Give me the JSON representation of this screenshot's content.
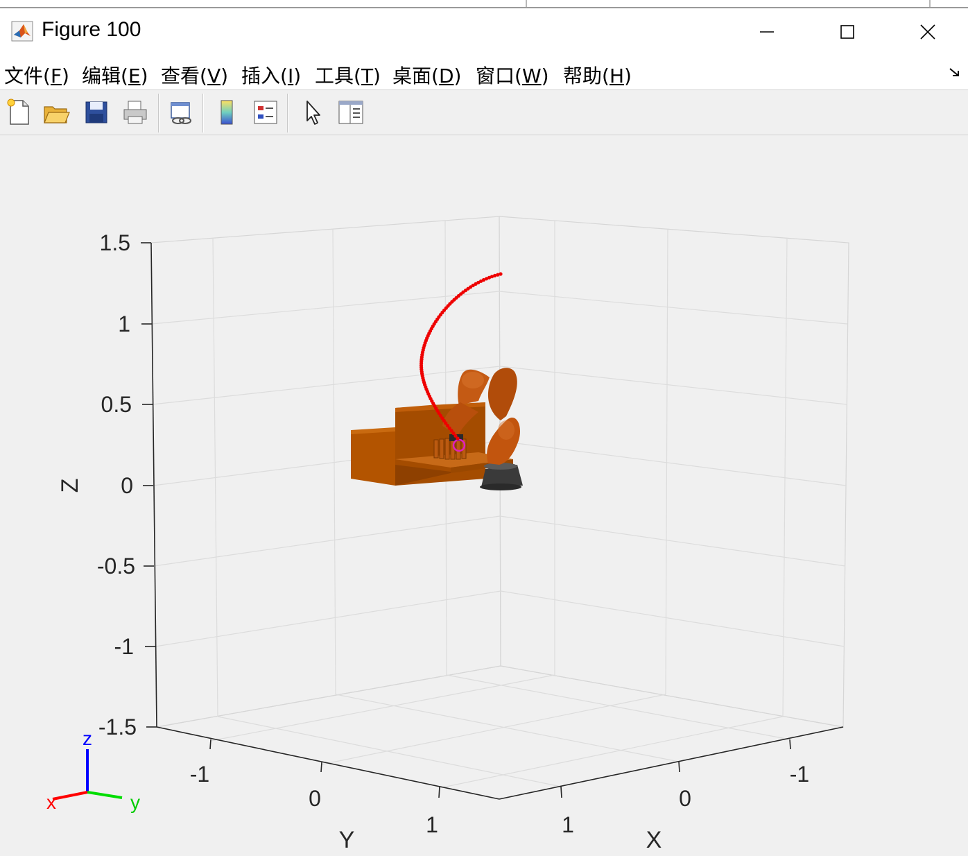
{
  "window": {
    "title": "Figure 100",
    "controls": {
      "minimize": "minimize",
      "maximize": "maximize",
      "close": "close"
    }
  },
  "menu": [
    {
      "label": "文件(",
      "key": "F",
      "tail": ")"
    },
    {
      "label": "编辑(",
      "key": "E",
      "tail": ")"
    },
    {
      "label": "查看(",
      "key": "V",
      "tail": ")"
    },
    {
      "label": "插入(",
      "key": "I",
      "tail": ")"
    },
    {
      "label": "工具(",
      "key": "T",
      "tail": ")"
    },
    {
      "label": "桌面(",
      "key": "D",
      "tail": ")"
    },
    {
      "label": "窗口(",
      "key": "W",
      "tail": ")"
    },
    {
      "label": "帮助(",
      "key": "H",
      "tail": ")"
    }
  ],
  "toolbar": {
    "buttons": [
      "new-figure",
      "open-file",
      "save-figure",
      "print-figure",
      "link-plot",
      "insert-colorbar",
      "insert-legend",
      "edit-plot",
      "property-inspector"
    ]
  },
  "plot": {
    "z_ticks": [
      "1.5",
      "1",
      "0.5",
      "0",
      "-0.5",
      "-1",
      "-1.5"
    ],
    "y_ticks": [
      "-1",
      "0",
      "1"
    ],
    "x_ticks": [
      "-1",
      "0",
      "1"
    ],
    "z_label": "Z",
    "y_label": "Y",
    "x_label": "X",
    "triad": {
      "x": "x",
      "y": "y",
      "z": "z"
    },
    "colors": {
      "trajectory": "#ee0000",
      "robot": "#c2550e",
      "table": "#b35400",
      "base": "#333333",
      "marker": "#e020c0",
      "triad_x": "#ff0000",
      "triad_y": "#00dd00",
      "triad_z": "#0000ff",
      "grid": "#dcdcdc"
    }
  }
}
